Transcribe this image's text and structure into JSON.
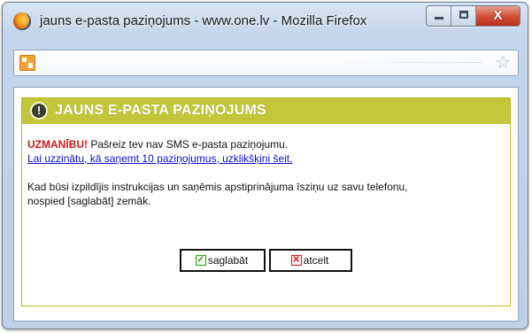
{
  "window": {
    "title": "jauns e-pasta paziņojums - www.one.lv - Mozilla Firefox",
    "controls": {
      "minimize_icon": "minimize-icon",
      "maximize_icon": "maximize-icon",
      "close_glyph": "X"
    }
  },
  "urlbar": {
    "site_icon": "site-favicon",
    "bookmark_icon": "star-icon",
    "bookmark_glyph": "☆"
  },
  "notice": {
    "header_icon_glyph": "!",
    "header_title": "JAUNS E-PASTA PAZIŅOJUMS",
    "warning_label": "UZMANĪBU!",
    "warning_text": " Pašreiz tev nav SMS e-pasta paziņojumu.",
    "link_text": "Lai uzzinātu, kā saņemt 10 paziņojumus, uzklikšķini šeit.",
    "instruction_line1": "Kad būsi izpildījis instrukcijas un saņēmis apstiprinājuma īsziņu uz savu telefonu,",
    "instruction_line2": "nospied [saglabāt] zemāk.",
    "save_label": "saglabāt",
    "cancel_label": "atcelt",
    "save_icon_glyph": "✓",
    "cancel_icon_glyph": "✕"
  },
  "colors": {
    "header_bg": "#c2c73a",
    "warning": "#d11a1a",
    "link": "#1010c8"
  }
}
